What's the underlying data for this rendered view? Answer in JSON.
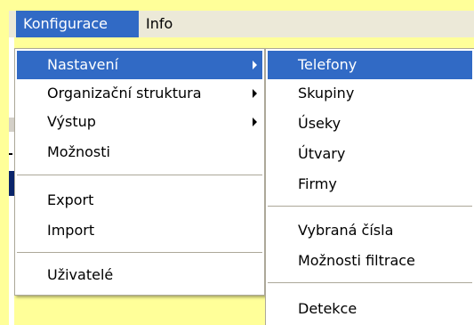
{
  "menubar": {
    "items": [
      "Konfigurace",
      "Info"
    ]
  },
  "main_menu": {
    "items": [
      {
        "label": "Nastavení",
        "submenu": true,
        "highlighted": true
      },
      {
        "label": "Organizační struktura",
        "submenu": true
      },
      {
        "label": "Výstup",
        "submenu": true
      },
      {
        "label": "Možnosti"
      },
      {
        "label": "Export"
      },
      {
        "label": "Import"
      },
      {
        "label": "Uživatelé"
      }
    ]
  },
  "settings_submenu": {
    "items": [
      {
        "label": "Telefony",
        "highlighted": true
      },
      {
        "label": "Skupiny"
      },
      {
        "label": "Úseky"
      },
      {
        "label": "Útvary"
      },
      {
        "label": "Firmy"
      },
      {
        "label": "Vybraná čísla"
      },
      {
        "label": "Možnosti filtrace"
      },
      {
        "label": "Detekce"
      }
    ]
  },
  "colors": {
    "highlight": "#316ac5",
    "background": "#ffff99",
    "menubar": "#ece9d8"
  }
}
